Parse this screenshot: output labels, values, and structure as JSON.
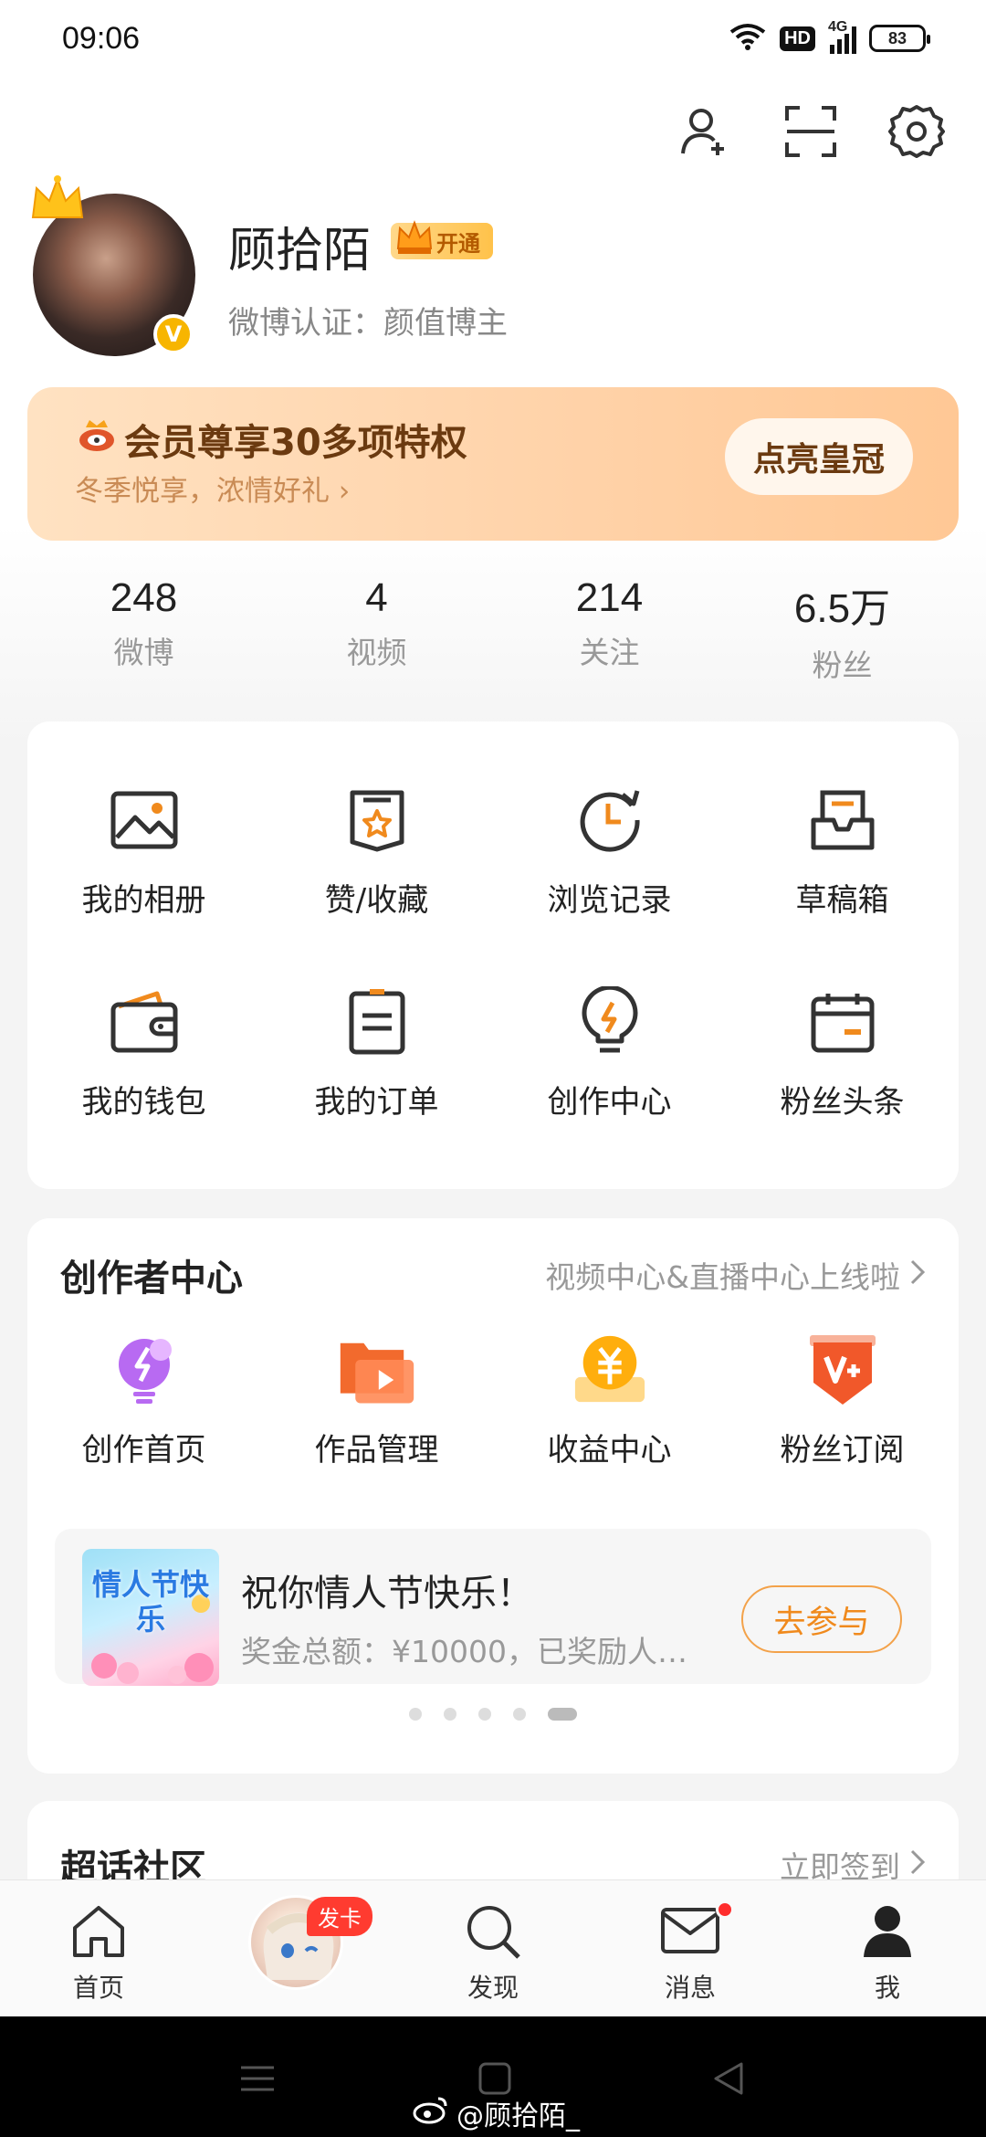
{
  "status_bar": {
    "time": "09:06",
    "network_badge": "HD",
    "network_type": "4G",
    "battery": "83"
  },
  "top_actions": [
    "add-user-icon",
    "scan-icon",
    "settings-icon"
  ],
  "profile": {
    "name": "顾拾陌",
    "vip_label": "开通",
    "verification": "微博认证：颜值博主"
  },
  "vip_banner": {
    "title": "会员尊享30多项特权",
    "subtitle": "冬季悦享，浓情好礼",
    "cta": "点亮皇冠"
  },
  "stats": [
    {
      "value": "248",
      "label": "微博"
    },
    {
      "value": "4",
      "label": "视频"
    },
    {
      "value": "214",
      "label": "关注"
    },
    {
      "value": "6.5万",
      "label": "粉丝"
    }
  ],
  "tools": [
    {
      "label": "我的相册",
      "icon": "photo-album-icon"
    },
    {
      "label": "赞/收藏",
      "icon": "favorites-icon"
    },
    {
      "label": "浏览记录",
      "icon": "history-icon"
    },
    {
      "label": "草稿箱",
      "icon": "drafts-icon"
    },
    {
      "label": "我的钱包",
      "icon": "wallet-icon"
    },
    {
      "label": "我的订单",
      "icon": "orders-icon"
    },
    {
      "label": "创作中心",
      "icon": "creation-icon"
    },
    {
      "label": "粉丝头条",
      "icon": "fan-headline-icon"
    }
  ],
  "creator_center": {
    "title": "创作者中心",
    "link": "视频中心&直播中心上线啦",
    "items": [
      {
        "label": "创作首页",
        "icon": "creation-home-icon"
      },
      {
        "label": "作品管理",
        "icon": "works-manage-icon"
      },
      {
        "label": "收益中心",
        "icon": "earnings-icon"
      },
      {
        "label": "粉丝订阅",
        "icon": "fan-subscribe-icon"
      }
    ],
    "promo": {
      "image_text": "情人节快乐",
      "title": "祝你情人节快乐！",
      "subtitle": "奖金总额：¥10000，已奖励人…",
      "button": "去参与"
    },
    "carousel_pages": 5,
    "carousel_active": 5
  },
  "super_topic": {
    "title": "超话社区",
    "link": "立即签到"
  },
  "bottom_nav": {
    "items": [
      {
        "label": "首页",
        "icon": "home-icon"
      },
      {
        "label": "",
        "icon": "publish-avatar",
        "badge": "发卡"
      },
      {
        "label": "发现",
        "icon": "discover-icon"
      },
      {
        "label": "消息",
        "icon": "message-icon"
      },
      {
        "label": "我",
        "icon": "profile-icon"
      }
    ]
  },
  "watermark": "@顾拾陌_",
  "colors": {
    "accent_orange": "#f08a1d",
    "vip_banner": "#ffd2a8",
    "badge_red": "#ff3b30"
  }
}
